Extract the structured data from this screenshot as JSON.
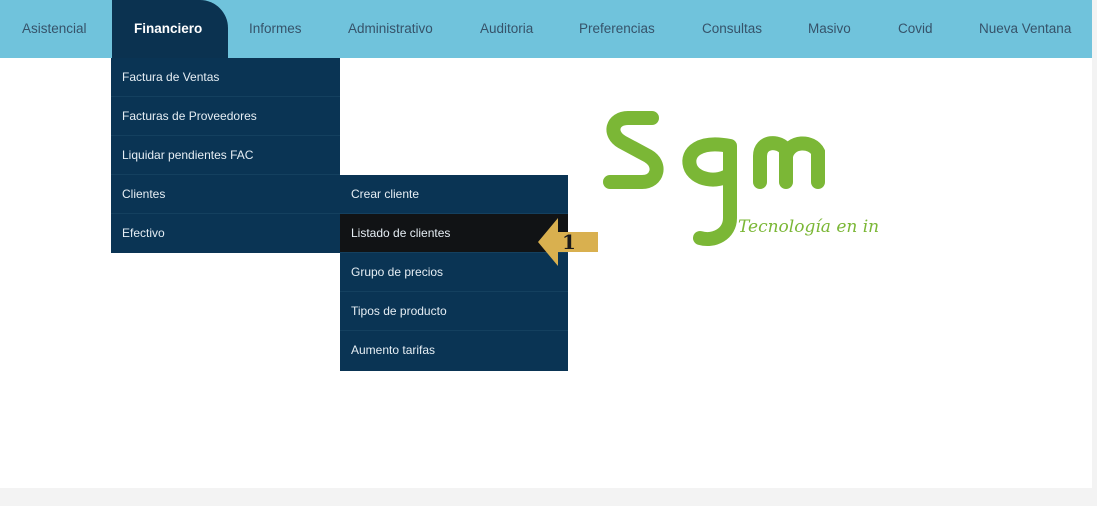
{
  "nav": {
    "items": [
      "Asistencial",
      "Financiero",
      "Informes",
      "Administrativo",
      "Auditoria",
      "Preferencias",
      "Consultas",
      "Masivo",
      "Covid",
      "Nueva Ventana"
    ],
    "active": "Financiero"
  },
  "financiero_menu": {
    "items": [
      "Factura de Ventas",
      "Facturas de Proveedores",
      "Liquidar pendientes FAC",
      "Clientes",
      "Efectivo"
    ]
  },
  "clientes_submenu": {
    "items": [
      "Crear cliente",
      "Listado de clientes",
      "Grupo de precios",
      "Tipos de producto",
      "Aumento tarifas"
    ],
    "active": "Listado de clientes"
  },
  "logo": {
    "text": "sgm",
    "tagline": "Tecnología en internet"
  },
  "callout": {
    "number": "1"
  },
  "colors": {
    "topbar": "#70c3dc",
    "menu": "#0a3454",
    "active_item": "#111315",
    "logo_green": "#7bb736",
    "callout": "#d9b04f"
  }
}
